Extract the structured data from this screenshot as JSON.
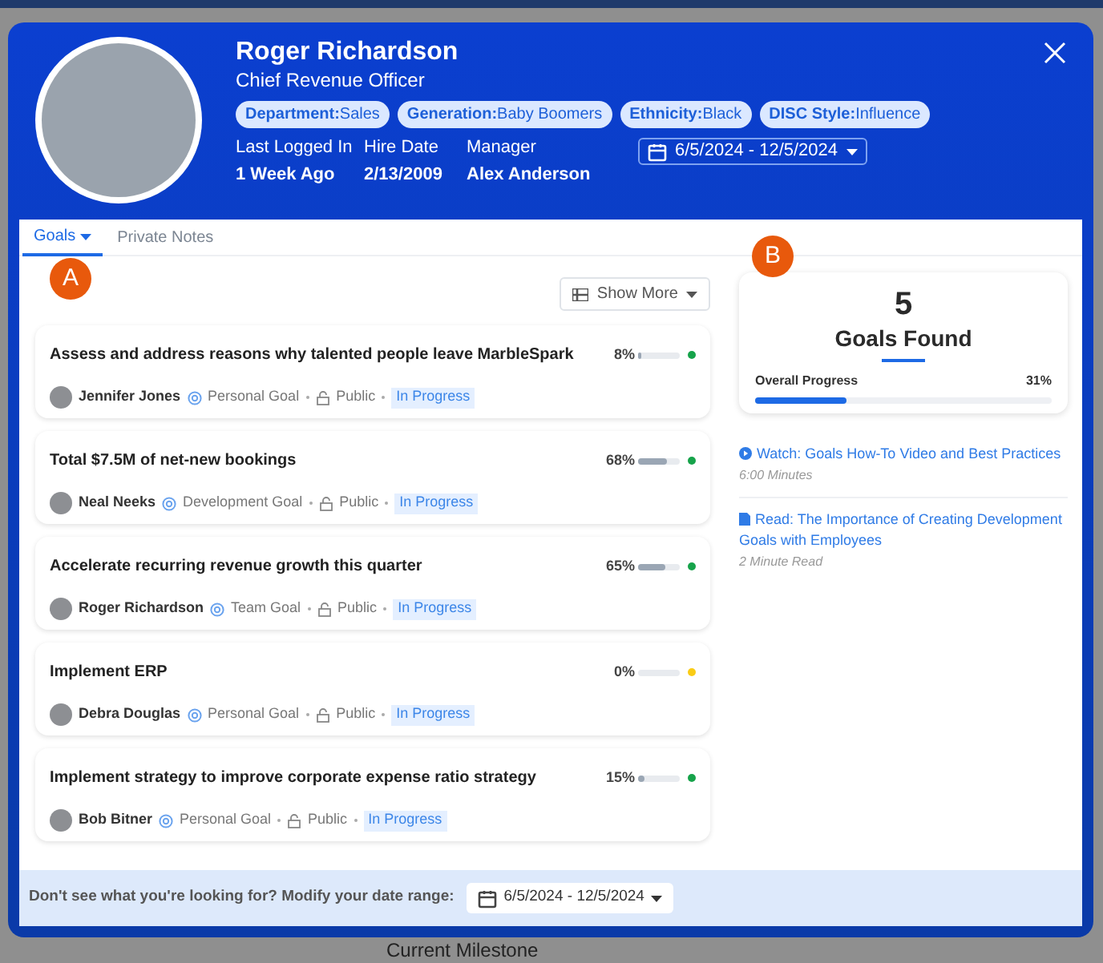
{
  "profile": {
    "name": "Roger Richardson",
    "title": "Chief Revenue Officer",
    "tags": [
      {
        "key": "Department:",
        "value": "Sales"
      },
      {
        "key": "Generation:",
        "value": "Baby Boomers"
      },
      {
        "key": "Ethnicity:",
        "value": "Black"
      },
      {
        "key": "DISC Style:",
        "value": "Influence"
      }
    ],
    "facts": [
      {
        "label": "Last Logged In",
        "value": "1 Week Ago"
      },
      {
        "label": "Hire Date",
        "value": "2/13/2009"
      },
      {
        "label": "Manager",
        "value": "Alex Anderson"
      }
    ],
    "date_range": "6/5/2024 - 12/5/2024"
  },
  "tabs": [
    {
      "label": "Goals",
      "selected": true
    },
    {
      "label": "Private Notes",
      "selected": false
    }
  ],
  "annotations": [
    "A",
    "B"
  ],
  "show_more": "Show More",
  "goals": [
    {
      "title": "Assess and address reasons why talented people leave MarbleSpark",
      "owner": "Jennifer Jones",
      "type": "Personal Goal",
      "visibility": "Public",
      "status": "In Progress",
      "percent": "8%",
      "level": 0.08,
      "color": "#16a34a"
    },
    {
      "title": "Total $7.5M of net-new bookings",
      "owner": "Neal Neeks",
      "type": "Development Goal",
      "visibility": "Public",
      "status": "In Progress",
      "percent": "68%",
      "level": 0.68,
      "color": "#16a34a"
    },
    {
      "title": "Accelerate recurring revenue growth this quarter",
      "owner": "Roger Richardson",
      "type": "Team Goal",
      "visibility": "Public",
      "status": "In Progress",
      "percent": "65%",
      "level": 0.65,
      "color": "#16a34a"
    },
    {
      "title": "Implement ERP",
      "owner": "Debra Douglas",
      "type": "Personal Goal",
      "visibility": "Public",
      "status": "In Progress",
      "percent": "0%",
      "level": 0,
      "color": "#facc15"
    },
    {
      "title": "Implement strategy to improve corporate expense ratio strategy",
      "owner": "Bob Bitner",
      "type": "Personal Goal",
      "visibility": "Public",
      "status": "In Progress",
      "percent": "15%",
      "level": 0.15,
      "color": "#16a34a"
    }
  ],
  "summary": {
    "count": "5",
    "label": "Goals Found",
    "progress_label": "Overall Progress",
    "percent": "31%",
    "level": 0.31
  },
  "resources": [
    {
      "kind": "video",
      "title": "Watch: Goals How-To Video and Best Practices",
      "meta": "6:00 Minutes"
    },
    {
      "kind": "doc",
      "title": "Read: The Importance of Creating Development Goals with Employees",
      "meta": "2 Minute Read"
    }
  ],
  "footer": {
    "prompt": "Don't see what you're looking for? Modify your date range:",
    "date_range": "6/5/2024 - 12/5/2024"
  },
  "background": {
    "milestone": "Current Milestone"
  }
}
